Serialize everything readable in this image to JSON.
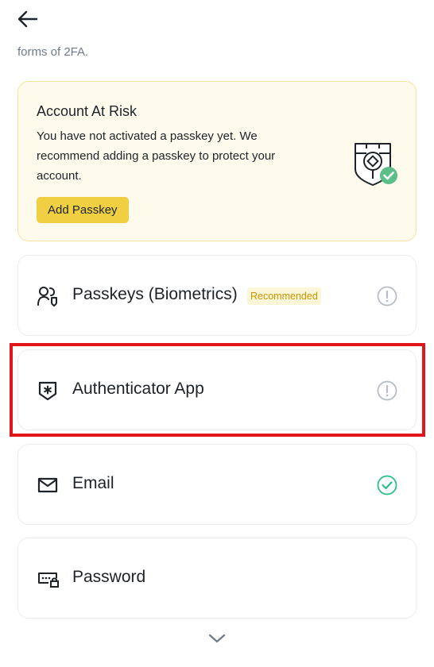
{
  "header": {
    "subtitle": "forms of 2FA."
  },
  "risk_card": {
    "title": "Account At Risk",
    "text": "You have not activated a passkey yet. We recommend adding a passkey to protect your account.",
    "button_label": "Add Passkey",
    "background": "#fefbec",
    "button_color": "#f0d042"
  },
  "methods": [
    {
      "label": "Passkeys (Biometrics)",
      "badge": "Recommended",
      "status": "warning",
      "icon": "passkey-users-icon"
    },
    {
      "label": "Authenticator App",
      "status": "warning",
      "icon": "authenticator-shield-icon"
    },
    {
      "label": "Email",
      "status": "enabled",
      "icon": "envelope-icon"
    },
    {
      "label": "Password",
      "icon": "password-lock-icon"
    }
  ],
  "colors": {
    "highlight": "#e0161b",
    "enabled_green": "#2ebd85",
    "warning_gray": "#b7bdc6",
    "badge_text": "#c99400"
  }
}
